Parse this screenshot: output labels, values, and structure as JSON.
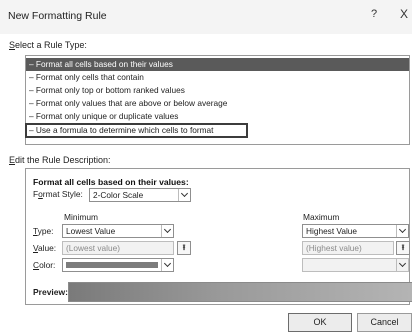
{
  "dialog": {
    "title": "New Formatting Rule",
    "help_label": "?",
    "close_label": "X"
  },
  "rule_type": {
    "label_accesskey": "S",
    "label_rest": "elect a Rule Type:",
    "items": [
      {
        "label": "Format all cells based on their values",
        "selected": true
      },
      {
        "label": "Format only cells that contain",
        "selected": false
      },
      {
        "label": "Format only top or bottom ranked values",
        "selected": false
      },
      {
        "label": "Format only values that are above or below average",
        "selected": false
      },
      {
        "label": "Format only unique or duplicate values",
        "selected": false
      },
      {
        "label": "Use a formula to determine which cells to format",
        "selected": false,
        "highlighted_box": true
      }
    ]
  },
  "rule_description": {
    "label_accesskey": "E",
    "label_rest": "dit the Rule Description:",
    "heading": "Format all cells based on their values:",
    "format_style_accesskey": "o",
    "format_style_pre": "F",
    "format_style_rest": "rmat Style:",
    "format_style_value": "2-Color Scale",
    "minimum": {
      "heading": "Minimum",
      "type_value": "Lowest Value",
      "value_placeholder": "(Lowest value)",
      "color": "#7c7c7c"
    },
    "maximum": {
      "heading": "Maximum",
      "type_value": "Highest Value",
      "value_placeholder": "(Highest value)"
    },
    "type_accesskey": "T",
    "type_rest": "ype:",
    "value_accesskey": "V",
    "value_rest": "alue:",
    "color_accesskey": "C",
    "color_rest": "olor:",
    "preview_label": "Preview:",
    "picker_glyph": "⭱"
  },
  "buttons": {
    "ok": "OK",
    "cancel": "Cancel"
  },
  "colors": {
    "selected_row": "#5a5a5a",
    "preview_start": "#7a7a7a",
    "preview_end": "#b4b4b4"
  }
}
